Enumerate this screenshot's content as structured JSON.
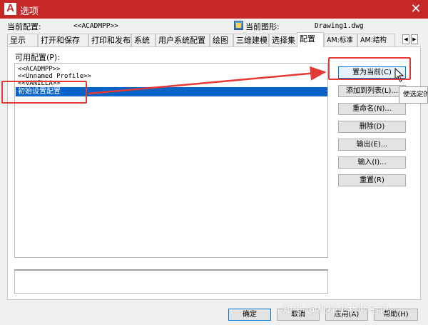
{
  "window": {
    "title": "选项",
    "app_icon_letter": "A",
    "close_glyph": "✕"
  },
  "header": {
    "current_profile_label": "当前配置:",
    "current_profile_value": "<<ACADMPP>>",
    "current_drawing_label": "当前图形:",
    "current_drawing_value": "Drawing1.dwg"
  },
  "tabs": [
    {
      "label": "显示"
    },
    {
      "label": "打开和保存"
    },
    {
      "label": "打印和发布"
    },
    {
      "label": "系统"
    },
    {
      "label": "用户系统配置"
    },
    {
      "label": "绘图"
    },
    {
      "label": "三维建模"
    },
    {
      "label": "选择集"
    },
    {
      "label": "配置",
      "active": true
    },
    {
      "label": "AM:标准"
    },
    {
      "label": "AM:结构"
    }
  ],
  "tab_scroll": {
    "left": "◀",
    "right": "▶"
  },
  "profiles": {
    "label": "可用配置(P):",
    "items": [
      "<<ACADMPP>>",
      "<<Unnamed Profile>>",
      "<<VANILLA>>",
      "初始设置配置"
    ],
    "selected_index": 3
  },
  "side_buttons": [
    "置为当前(C)",
    "添加到列表(L)...",
    "重命名(N)...",
    "删除(D)",
    "输出(E)...",
    "输入(I)...",
    "重置(R)"
  ],
  "tooltip": "使选定的",
  "bottom_buttons": [
    "确定",
    "取消",
    "应用(A)",
    "帮助(H)"
  ],
  "watermark": "知乎 @机械工程师笔记",
  "colors": {
    "titlebar": "#c62828",
    "selection": "#0a64c8",
    "annotation": "#e53935"
  }
}
